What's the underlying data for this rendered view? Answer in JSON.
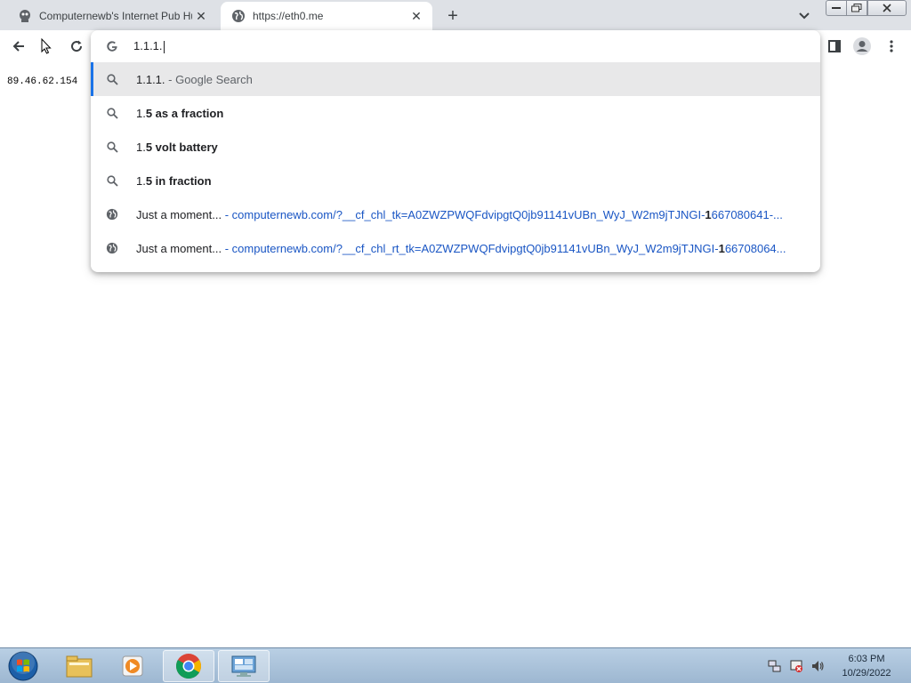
{
  "tabs": [
    {
      "title": "Computernewb's Internet Pub Hu",
      "icon": "computernewb-favicon-icon"
    },
    {
      "title": "https://eth0.me",
      "icon": "globe-icon"
    }
  ],
  "new_tab_label": "+",
  "omnibox": {
    "input_value": "1.1.1.",
    "suggestions": [
      {
        "type": "search",
        "prefix": "1.1.1.",
        "bold": "",
        "suffix": " - Google Search"
      },
      {
        "type": "search",
        "prefix": "1.",
        "bold": "5 as a fraction",
        "suffix": ""
      },
      {
        "type": "search",
        "prefix": "1.",
        "bold": "5 volt battery",
        "suffix": ""
      },
      {
        "type": "search",
        "prefix": "1.",
        "bold": "5 in fraction",
        "suffix": ""
      },
      {
        "type": "history",
        "title": "Just a moment...",
        "sep": " - ",
        "url_a": "computernewb.com/?__cf_chl_tk=A0ZWZPWQFdvipgtQ0jb91141vUBn_WyJ_W2m9jTJNGI-",
        "url_bold": "1",
        "url_b": "667080641-..."
      },
      {
        "type": "history",
        "title": "Just a moment...",
        "sep": " - ",
        "url_a": "computernewb.com/?__cf_chl_rt_tk=A0ZWZPWQFdvipgtQ0jb91141vUBn_WyJ_W2m9jTJNGI-",
        "url_bold": "1",
        "url_b": "66708064..."
      }
    ]
  },
  "page": {
    "ip_text": "89.46.62.154"
  },
  "clock": {
    "time": "6:03 PM",
    "date": "10/29/2022"
  },
  "colors": {
    "accent": "#1a73e8",
    "link": "#1a56c4",
    "tabbar": "#dee1e6"
  }
}
